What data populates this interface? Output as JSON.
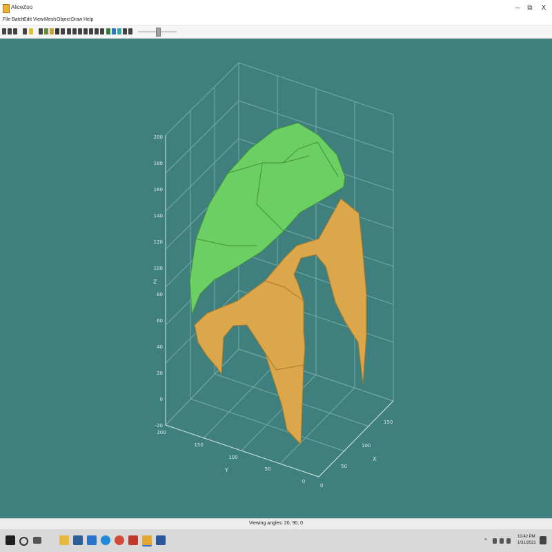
{
  "window": {
    "title": "AliceZoo",
    "minimize_label": "–",
    "restore_label": "⧉",
    "close_label": "X"
  },
  "menu": [
    "File",
    "Batch",
    "Edit",
    "View",
    "Mesh",
    "Object",
    "Draw",
    "Help"
  ],
  "toolbar": {
    "buttons": 22,
    "slider_value_fraction": 0.46
  },
  "plot": {
    "z_axis_label": "Z",
    "y_axis_label": "Y",
    "x_axis_label": "X",
    "z_ticks": [
      "200",
      "180",
      "160",
      "140",
      "120",
      "100",
      "80",
      "60",
      "40",
      "20",
      "0",
      "-20"
    ],
    "y_ticks": [
      "200",
      "150",
      "100",
      "50",
      "0"
    ],
    "x_ticks": [
      "150",
      "100",
      "50",
      "0"
    ],
    "colors": {
      "background": "#3f7f7d",
      "green_part": "#6ccf63",
      "orange_part": "#dba74a",
      "grid": "#9fcac6"
    }
  },
  "status": {
    "text": "Viewing angles: 20, 90, 0"
  },
  "taskbar": {
    "icons": [
      "windows-start-icon",
      "search-icon",
      "task-view-icon",
      "file-explorer-icon",
      "store-icon",
      "mail-icon",
      "edge-icon",
      "chrome-icon",
      "matlab-icon",
      "app-icon",
      "word-icon"
    ],
    "time": "10:42 PM",
    "date": "1/31/2021"
  }
}
